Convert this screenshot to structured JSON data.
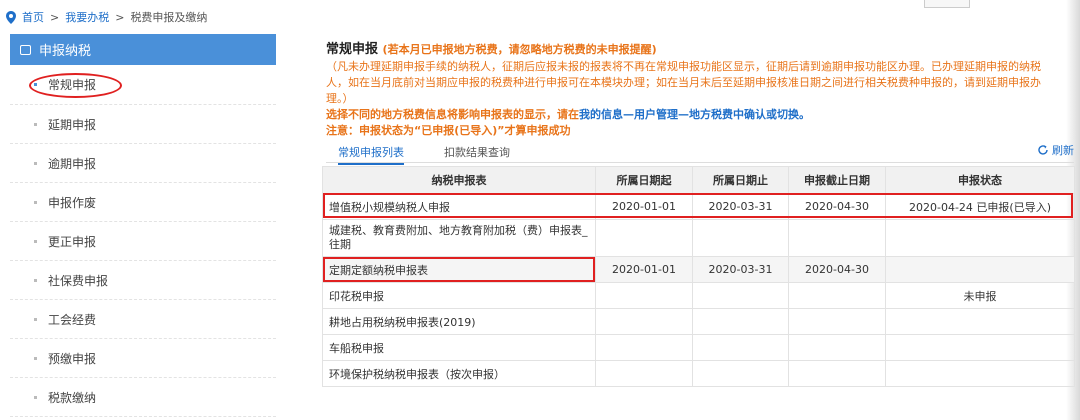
{
  "breadcrumb": {
    "home": "首页",
    "sep": ">",
    "level2": "我要办税",
    "level3": "税费申报及缴纳"
  },
  "sidebar": {
    "header": "申报纳税",
    "items": [
      {
        "label": "常规申报"
      },
      {
        "label": "延期申报"
      },
      {
        "label": "逾期申报"
      },
      {
        "label": "申报作废"
      },
      {
        "label": "更正申报"
      },
      {
        "label": "社保费申报"
      },
      {
        "label": "工会经费"
      },
      {
        "label": "预缴申报"
      },
      {
        "label": "税款缴纳"
      }
    ]
  },
  "main": {
    "title": "常规申报",
    "title_warn": "(若本月已申报地方税费，请忽略地方税费的未申报提醒)",
    "note_lines": [
      "（凡未办理延期申报手续的纳税人，征期后应报未报的报表将不再在常规申报功能区显示，征期后请到逾期申报功能区办理。已办理延期申报的纳税",
      "人，如在当月底前对当期应申报的税费种进行申报可在本模块办理；如在当月末后至延期申报核准日期之间进行相关税费种申报的，请到延期申报办",
      "理。）"
    ],
    "select_pre": "选择不同的地方税费信息将影响申报表的显示，请在",
    "select_link": "我的信息—用户管理—地方税费中确认或切换。",
    "attention": "注意：申报状态为“已申报(已导入)”才算申报成功"
  },
  "tabs": {
    "list": "常规申报列表",
    "deduct": "扣款结果查询",
    "refresh": "刷新"
  },
  "table": {
    "headers": [
      "纳税申报表",
      "所属日期起",
      "所属日期止",
      "申报截止日期",
      "申报状态"
    ],
    "rows": [
      {
        "name": "增值税小规模纳税人申报",
        "start": "2020-01-01",
        "end": "2020-03-31",
        "due": "2020-04-30",
        "status": "2020-04-24 已申报(已导入)"
      },
      {
        "name": "城建税、教育费附加、地方教育附加税（费）申报表_往期",
        "start": "",
        "end": "",
        "due": "",
        "status": ""
      },
      {
        "name": "定期定额纳税申报表",
        "start": "2020-01-01",
        "end": "2020-03-31",
        "due": "2020-04-30",
        "status": ""
      },
      {
        "name": "印花税申报",
        "start": "",
        "end": "",
        "due": "",
        "status": "未申报"
      },
      {
        "name": "耕地占用税纳税申报表(2019)",
        "start": "",
        "end": "",
        "due": "",
        "status": ""
      },
      {
        "name": "车船税申报",
        "start": "",
        "end": "",
        "due": "",
        "status": ""
      },
      {
        "name": "环境保护税纳税申报表（按次申报）",
        "start": "",
        "end": "",
        "due": "",
        "status": ""
      }
    ]
  },
  "colors": {
    "accent": "#4a90d9",
    "link": "#1f6fc9",
    "warning": "#e8741a",
    "annotation": "#e02020"
  }
}
